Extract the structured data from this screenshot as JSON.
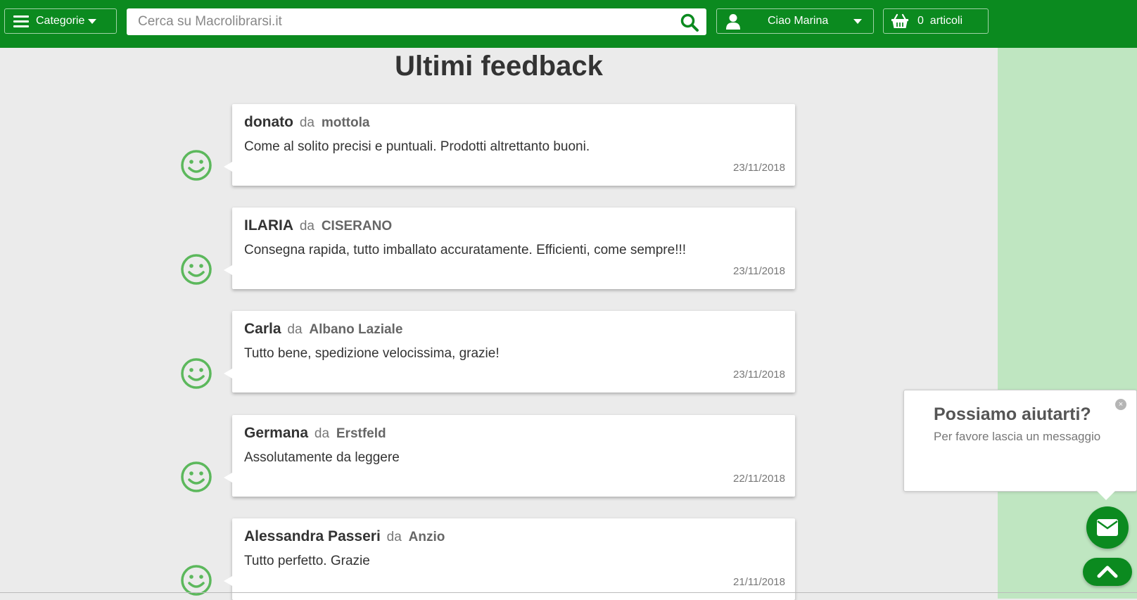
{
  "header": {
    "categories_label": "Categorie",
    "search_placeholder": "Cerca su Macrolibrarsi.it",
    "user_label": "Ciao Marina",
    "cart_label": "0  articoli"
  },
  "page": {
    "title": "Ultimi feedback"
  },
  "feedbacks": [
    {
      "name": "donato",
      "da": "da",
      "city": "mottola",
      "text": "Come al solito precisi e puntuali. Prodotti altrettanto buoni.",
      "date": "23/11/2018"
    },
    {
      "name": "ILARIA",
      "da": "da",
      "city": "CISERANO",
      "text": "Consegna rapida, tutto imballato accuratamente. Efficienti, come sempre!!!",
      "date": "23/11/2018"
    },
    {
      "name": "Carla",
      "da": "da",
      "city": "Albano Laziale",
      "text": "Tutto bene, spedizione velocissima, grazie!",
      "date": "23/11/2018"
    },
    {
      "name": "Germana",
      "da": "da",
      "city": "Erstfeld",
      "text": "Assolutamente da leggere",
      "date": "22/11/2018"
    },
    {
      "name": "Alessandra Passeri",
      "da": "da",
      "city": "Anzio",
      "text": "Tutto perfetto. Grazie",
      "date": "21/11/2018"
    }
  ],
  "chat": {
    "title": "Possiamo aiutarti?",
    "subtitle": "Per favore lascia un messaggio",
    "close_symbol": "×"
  },
  "colors": {
    "header_green": "#0b8a1f",
    "smiley_green": "#5cb85c",
    "side_panel": "#bfe6c1"
  },
  "icons": [
    "hamburger-icon",
    "caret-down-icon",
    "search-icon",
    "user-icon",
    "basket-icon",
    "smiley-icon",
    "mail-icon",
    "chevron-up-icon",
    "close-icon"
  ]
}
